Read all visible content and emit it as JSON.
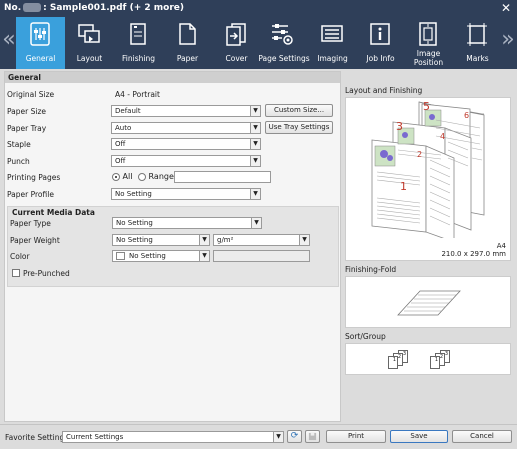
{
  "window": {
    "title_prefix": "No.",
    "title_file": ": Sample001.pdf (+ 2 more)",
    "close": "✕"
  },
  "nav": {
    "prev": "«",
    "next": "»"
  },
  "tabs": [
    {
      "label": "General"
    },
    {
      "label": "Layout"
    },
    {
      "label": "Finishing"
    },
    {
      "label": "Paper"
    },
    {
      "label": "Cover"
    },
    {
      "label": "Page Settings"
    },
    {
      "label": "Imaging"
    },
    {
      "label": "Job Info"
    },
    {
      "label": "Image Position"
    },
    {
      "label": "Marks"
    }
  ],
  "general": {
    "header": "General",
    "original_size": {
      "label": "Original Size",
      "value": "A4 - Portrait"
    },
    "paper_size": {
      "label": "Paper Size",
      "value": "Default",
      "button": "Custom Size..."
    },
    "paper_tray": {
      "label": "Paper Tray",
      "value": "Auto",
      "button": "Use Tray Settings"
    },
    "staple": {
      "label": "Staple",
      "value": "Off"
    },
    "punch": {
      "label": "Punch",
      "value": "Off"
    },
    "printing_pages": {
      "label": "Printing Pages",
      "all": "All",
      "range": "Range"
    },
    "paper_profile": {
      "label": "Paper Profile",
      "value": "No Setting"
    }
  },
  "media": {
    "header": "Current Media Data",
    "paper_type": {
      "label": "Paper Type",
      "value": "No Setting"
    },
    "paper_weight": {
      "label": "Paper Weight",
      "value": "No Setting",
      "unit": "g/m²"
    },
    "color": {
      "label": "Color",
      "value": "No Setting"
    },
    "pre_punched": {
      "label": "Pre-Punched"
    }
  },
  "preview": {
    "layout_label": "Layout and Finishing",
    "page_numbers": [
      "5",
      "6",
      "3",
      "4",
      "1",
      "2"
    ],
    "size_name": "A4",
    "size_dims": "210.0 x 297.0 mm",
    "fold_label": "Finishing-Fold",
    "sort_label": "Sort/Group",
    "sort_numbers": [
      "3",
      "2",
      "1",
      "3",
      "2",
      "1"
    ]
  },
  "footer": {
    "favorite_label": "Favorite Setting",
    "favorite_value": "Current Settings",
    "print": "Print",
    "save": "Save",
    "cancel": "Cancel"
  },
  "colors": {
    "titlebar": "#2f3f59",
    "active_tab": "#3aa0dc",
    "page_number": "#c0392b"
  }
}
